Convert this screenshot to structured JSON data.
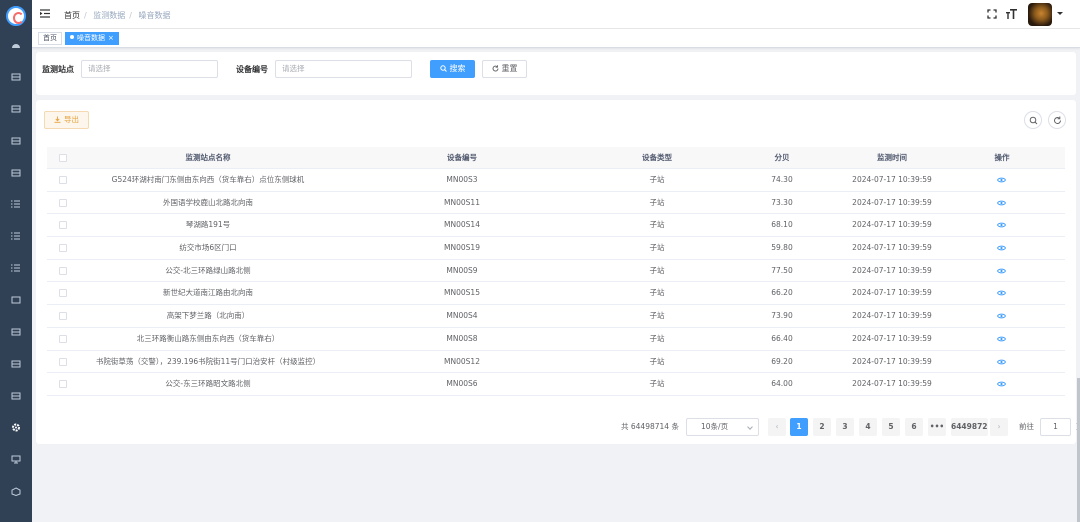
{
  "breadcrumb": [
    "首页",
    "监测数据",
    "噪音数据"
  ],
  "tags": {
    "home": "首页",
    "active": "噪音数据"
  },
  "search": {
    "station_label": "监测站点",
    "station_placeholder": "请选择",
    "device_label": "设备编号",
    "device_placeholder": "请选择",
    "search_btn": "搜索",
    "reset_btn": "重置"
  },
  "toolbar": {
    "export": "导出"
  },
  "table": {
    "headers": [
      "监测站点名称",
      "设备编号",
      "设备类型",
      "分贝",
      "监测时间",
      "操作"
    ],
    "rows": [
      [
        "G524环湖村南门东侧由东向西（货车靠右）点位东侧球机",
        "MN00S3",
        "子站",
        "74.30",
        "2024-07-17 10:39:59"
      ],
      [
        "外国语学校鹿山北路北向南",
        "MN00S11",
        "子站",
        "73.30",
        "2024-07-17 10:39:59"
      ],
      [
        "琴湖路191号",
        "MN00S14",
        "子站",
        "68.10",
        "2024-07-17 10:39:59"
      ],
      [
        "纺交市场6区门口",
        "MN00S19",
        "子站",
        "59.80",
        "2024-07-17 10:39:59"
      ],
      [
        "公交-北三环路绿山路北侧",
        "MN00S9",
        "子站",
        "77.50",
        "2024-07-17 10:39:59"
      ],
      [
        "新世纪大道南江路由北向南",
        "MN00S15",
        "子站",
        "66.20",
        "2024-07-17 10:39:59"
      ],
      [
        "高架下梦兰路（北向南）",
        "MN00S4",
        "子站",
        "73.90",
        "2024-07-17 10:39:59"
      ],
      [
        "北三环路衡山路东侧由东向西（货车靠右）",
        "MN00S8",
        "子站",
        "66.40",
        "2024-07-17 10:39:59"
      ],
      [
        "书院街草荡（交警），239.196书院街11号门口治安杆（村级监控）",
        "MN00S12",
        "子站",
        "69.20",
        "2024-07-17 10:39:59"
      ],
      [
        "公交-东三环路昭文路北侧",
        "MN00S6",
        "子站",
        "64.00",
        "2024-07-17 10:39:59"
      ]
    ]
  },
  "pagination": {
    "total": "共 64498714 条",
    "page_size": "10条/页",
    "pages": [
      "1",
      "2",
      "3",
      "4",
      "5",
      "6",
      "•••",
      "6449872"
    ],
    "jump_prefix": "前往",
    "jump_value": "1",
    "jump_suffix": "页"
  }
}
